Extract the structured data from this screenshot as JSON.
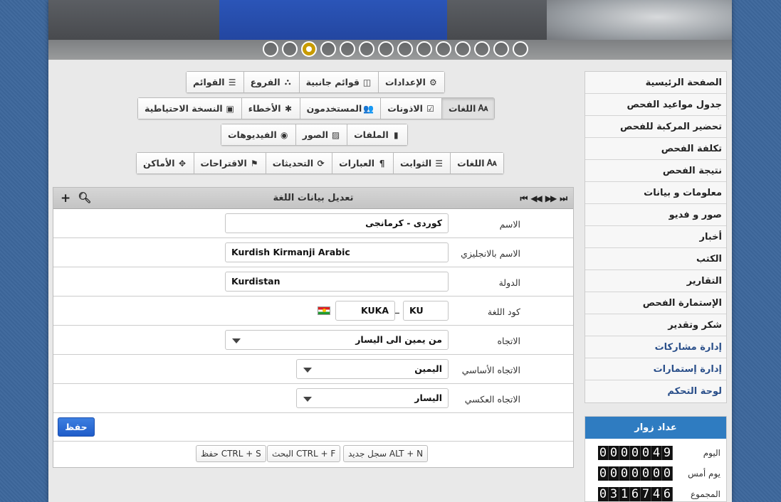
{
  "slider": {
    "dot_count": 14,
    "active_index": 2
  },
  "sidebar": {
    "items": [
      {
        "label": "الصفحة الرئيسية"
      },
      {
        "label": "جدول مواعيد الفحص"
      },
      {
        "label": "تحضير المركبة للفحص"
      },
      {
        "label": "تكلفة الفحص"
      },
      {
        "label": "نتيجة الفحص"
      },
      {
        "label": "معلومات و بيانات"
      },
      {
        "label": "صور و فديو"
      },
      {
        "label": "أخبار"
      },
      {
        "label": "الكتب"
      },
      {
        "label": "التقارير"
      },
      {
        "label": "الإستمارة الفحص"
      },
      {
        "label": "شكر وتقدير"
      },
      {
        "label": "إدارة مشاركات"
      },
      {
        "label": "إدارة إستمارات"
      },
      {
        "label": "لوحة التحكم"
      }
    ]
  },
  "counter": {
    "title": "عداد زوار",
    "rows": [
      {
        "label": "اليوم",
        "value": "0000049"
      },
      {
        "label": "يوم أمس",
        "value": "0000000"
      },
      {
        "label": "المجموع",
        "value": "0316746"
      }
    ]
  },
  "toolbar": {
    "row1": [
      "الإعدادات",
      "قوائم جانبية",
      "الفروع",
      "القوائم"
    ],
    "row2": [
      "اللغات",
      "الاذونات",
      "المستخدمون",
      "الأخطاء",
      "النسخة الاحتياطية"
    ],
    "row3": [
      "الملفات",
      "الصور",
      "الفيديوهات"
    ],
    "row4": [
      "اللغات",
      "الثوابت",
      "العبارات",
      "التحديثات",
      "الاقتراحات",
      "الأماكن"
    ]
  },
  "form": {
    "title": "تعديل بيانات اللغة",
    "name_label": "الاسم",
    "name_value": "كوردى - كرمانجى",
    "name_en_label": "الاسم بالانجليزي",
    "name_en_value": "Kurdish Kirmanji Arabic",
    "country_label": "الدولة",
    "country_value": "Kurdistan",
    "code_label": "كود اللغة",
    "code_part1": "KU",
    "code_sep": "_",
    "code_part2": "KUKA",
    "direction_label": "الاتجاه",
    "direction_value": "من يمين الى اليسار",
    "base_direction_label": "الاتجاه الأساسي",
    "base_direction_value": "اليمين",
    "reverse_direction_label": "الاتجاه العكسي",
    "reverse_direction_value": "اليسار",
    "save_label": "حفظ"
  },
  "shortcuts": [
    {
      "label": "ALT + N سجل جديد"
    },
    {
      "label": "CTRL + F البحث"
    },
    {
      "label": "CTRL + S حفظ"
    }
  ]
}
